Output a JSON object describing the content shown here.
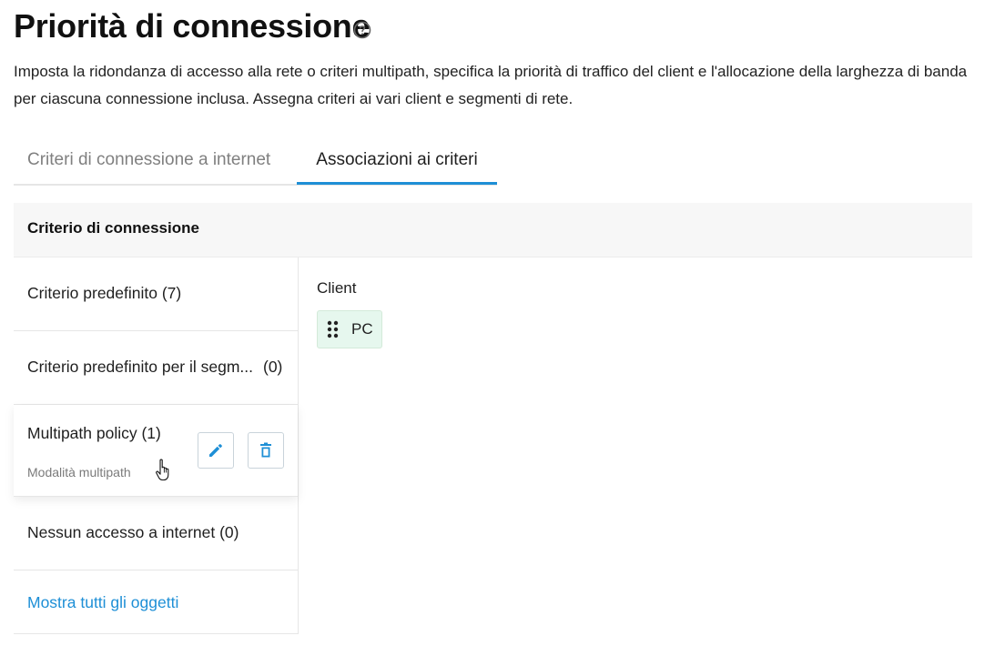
{
  "page": {
    "title": "Priorità di connessione",
    "description": "Imposta la ridondanza di accesso alla rete o criteri multipath, specifica la priorità di traffico del client e l'allocazione della larghezza di banda per ciascuna connessione inclusa. Assegna criteri ai vari client e segmenti di rete."
  },
  "tabs": [
    {
      "label": "Criteri di connessione a internet",
      "active": false
    },
    {
      "label": "Associazioni ai criteri",
      "active": true
    }
  ],
  "panel": {
    "header": "Criterio di connessione",
    "items": [
      {
        "label": "Criterio predefinito (7)"
      },
      {
        "label": "Criterio predefinito per il segm...",
        "count": "(0)"
      },
      {
        "label": "Multipath policy (1)",
        "sublabel": "Modalità multipath"
      },
      {
        "label": "Nessun accesso a internet (0)"
      }
    ],
    "show_all": "Mostra tutti gli oggetti"
  },
  "detail": {
    "clients_label": "Client",
    "clients": [
      {
        "name": "PC"
      }
    ]
  },
  "colors": {
    "accent": "#1e8fd6",
    "chip_bg": "#e6f7ee",
    "header_bg": "#f7f7f7"
  },
  "icons": {
    "help": "help-circle-icon",
    "edit": "pencil-icon",
    "delete": "trash-icon",
    "drag": "drag-handle-icon",
    "cursor": "hand-pointer-icon"
  }
}
